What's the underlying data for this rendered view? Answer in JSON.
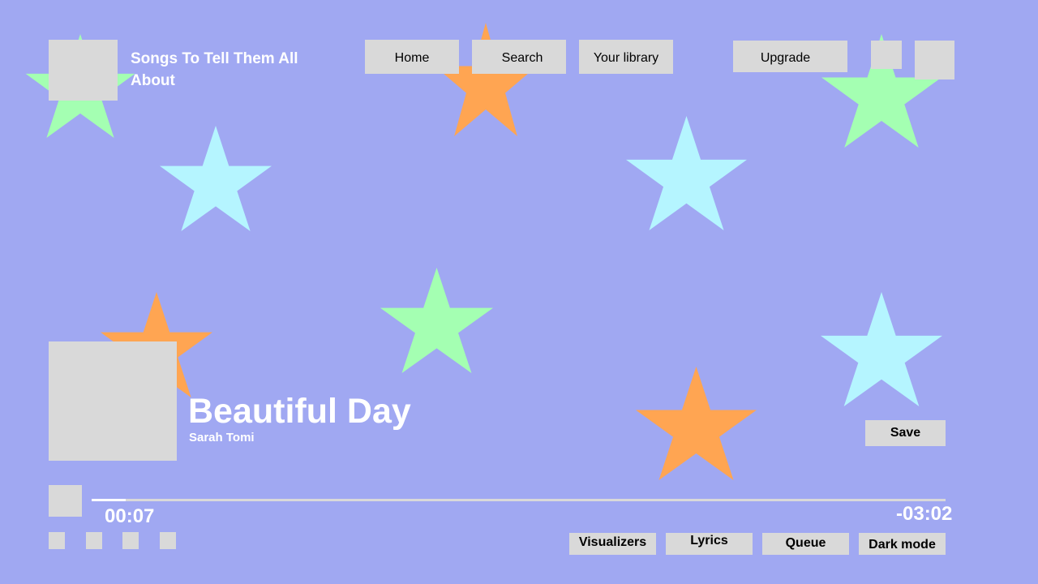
{
  "theme": {
    "background": "#A0A8F2",
    "surface": "#D9D9D9",
    "text_light": "#FFFFFF",
    "text_dark": "#000000",
    "star_colors": [
      "#A4FFB2",
      "#FFA552",
      "#B5F5FF"
    ]
  },
  "header": {
    "logo_icon": "logo-placeholder",
    "title": "Songs To Tell Them All About",
    "nav": {
      "home_label": "Home",
      "search_label": "Search",
      "library_label": "Your library",
      "upgrade_label": "Upgrade"
    },
    "notifications_icon": "bell-placeholder",
    "profile_icon": "avatar-placeholder"
  },
  "now_playing": {
    "album_art_icon": "album-art-placeholder",
    "song_title": "Beautiful Day",
    "artist": "Sarah Tomi",
    "save_label": "Save"
  },
  "player": {
    "play_icon": "play-placeholder",
    "elapsed": "00:07",
    "remaining": "-03:02",
    "progress_fraction": 0.04,
    "controls_icons": [
      "shuffle-placeholder",
      "previous-placeholder",
      "next-placeholder",
      "repeat-placeholder"
    ],
    "bottom_buttons": {
      "visualizers_label": "Visualizers",
      "lyrics_label": "Lyrics",
      "queue_label": "Queue",
      "dark_mode_label": "Dark mode"
    }
  }
}
